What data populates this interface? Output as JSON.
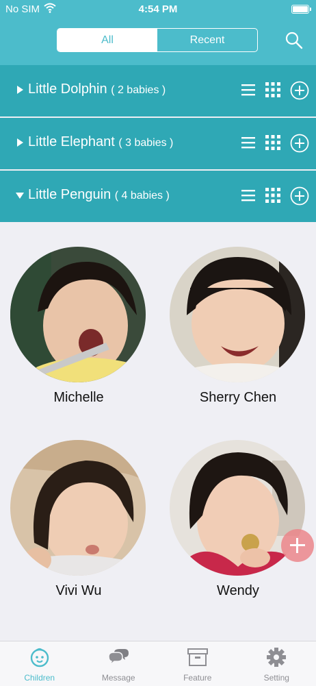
{
  "status_bar": {
    "carrier": "No SIM",
    "time": "4:54 PM"
  },
  "header": {
    "segments": [
      {
        "label": "All",
        "selected": true
      },
      {
        "label": "Recent",
        "selected": false
      }
    ],
    "search_icon": "search-icon"
  },
  "groups": [
    {
      "name": "Little Dolphin",
      "count_text": "( 2 babies )",
      "expanded": false
    },
    {
      "name": "Little Elephant",
      "count_text": "( 3 babies )",
      "expanded": false
    },
    {
      "name": "Little Penguin",
      "count_text": "( 4 babies )",
      "expanded": true
    }
  ],
  "children": [
    {
      "name": "Michelle"
    },
    {
      "name": "Sherry Chen"
    },
    {
      "name": "Vivi Wu"
    },
    {
      "name": "Wendy"
    }
  ],
  "tabbar": {
    "items": [
      {
        "label": "Children",
        "icon": "baby-face-icon",
        "active": true
      },
      {
        "label": "Message",
        "icon": "chat-bubbles-icon",
        "active": false
      },
      {
        "label": "Feature",
        "icon": "archive-box-icon",
        "active": false
      },
      {
        "label": "Setting",
        "icon": "gear-icon",
        "active": false
      }
    ]
  },
  "colors": {
    "header": "#4cbccb",
    "group_row": "#2fa8b5",
    "background": "#efeff4",
    "fab": "#ec8288"
  }
}
